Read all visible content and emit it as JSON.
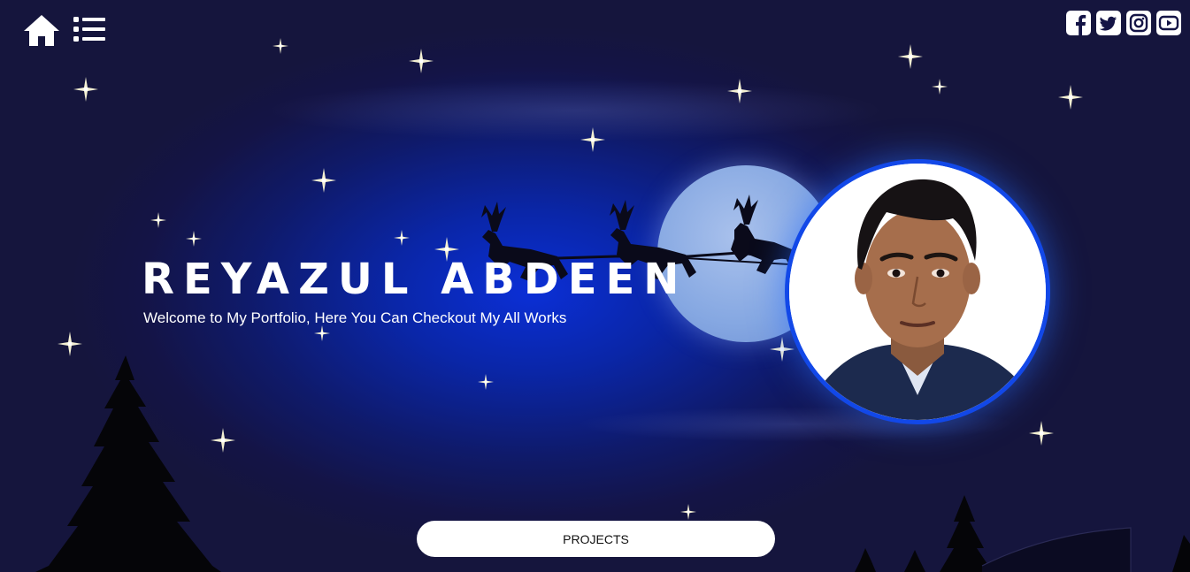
{
  "topbar": {
    "home_icon": "home-icon",
    "menu_icon": "list-menu-icon",
    "social": [
      {
        "name": "facebook-icon"
      },
      {
        "name": "twitter-icon"
      },
      {
        "name": "instagram-icon"
      },
      {
        "name": "youtube-icon"
      }
    ]
  },
  "hero": {
    "name": "REYAZUL ABDEEN",
    "tagline": "Welcome to My Portfolio, Here You Can Checkout My All Works",
    "photo_icon": "profile-photo"
  },
  "actions": {
    "projects_label": "PROJECTS"
  },
  "colors": {
    "background": "#141446",
    "glow": "#0b2fd6",
    "accent": "#1248e8",
    "text": "#ffffff"
  }
}
